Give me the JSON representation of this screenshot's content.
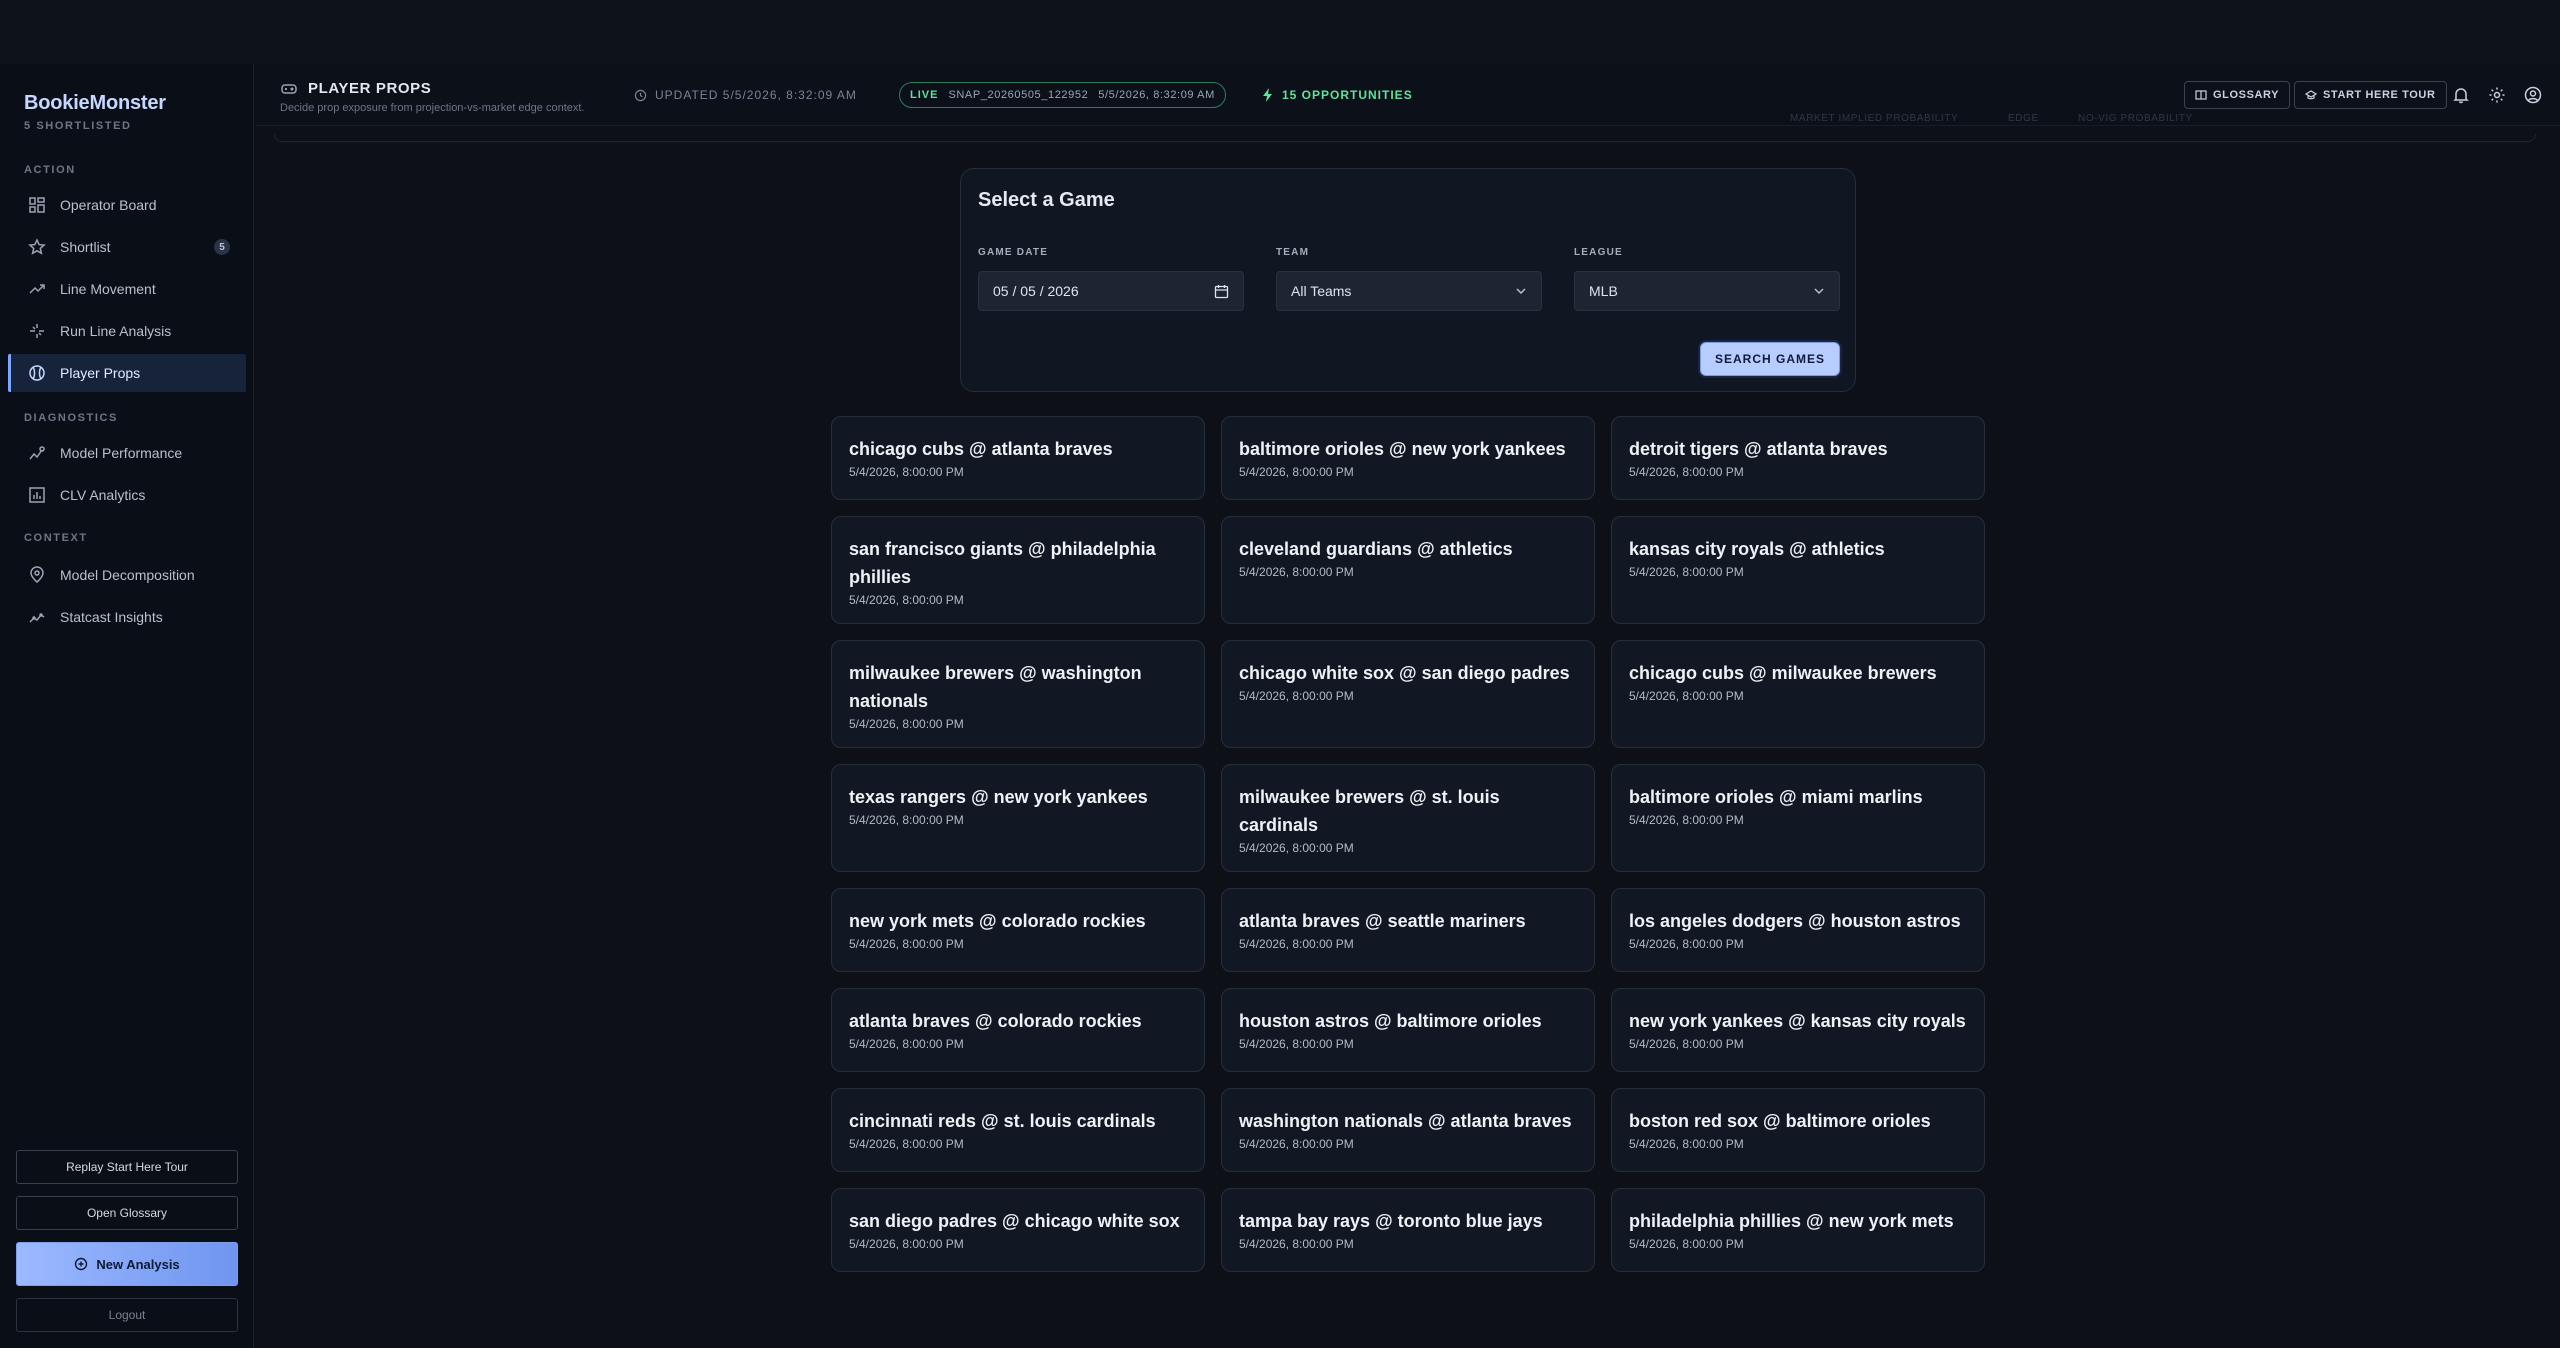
{
  "app": {
    "brand": "BookieMonster",
    "shortlisted": "5 SHORTLISTED"
  },
  "sidebar": {
    "sections": [
      {
        "label": "ACTION"
      },
      {
        "label": "DIAGNOSTICS"
      },
      {
        "label": "CONTEXT"
      }
    ],
    "items": [
      {
        "label": "Operator Board",
        "icon": "grid-icon"
      },
      {
        "label": "Shortlist",
        "icon": "star-icon",
        "badge": "5"
      },
      {
        "label": "Line Movement",
        "icon": "trend-up-icon"
      },
      {
        "label": "Run Line Analysis",
        "icon": "spread-icon"
      },
      {
        "label": "Player Props",
        "icon": "baseball-icon",
        "active": true
      },
      {
        "label": "Model Performance",
        "icon": "performance-icon"
      },
      {
        "label": "CLV Analytics",
        "icon": "bar-chart-icon"
      },
      {
        "label": "Model Decomposition",
        "icon": "decomposition-icon"
      },
      {
        "label": "Statcast Insights",
        "icon": "insights-icon"
      }
    ],
    "buttons": {
      "replay_tour": "Replay Start Here Tour",
      "open_glossary": "Open Glossary",
      "new_analysis": "New Analysis",
      "logout": "Logout"
    }
  },
  "header": {
    "title": "PLAYER PROPS",
    "description": "Decide prop exposure from projection-vs-market edge context.",
    "updated": "UPDATED 5/5/2026, 8:32:09 AM",
    "live_label": "LIVE",
    "snapshot": "SNAP_20260505_122952",
    "snapshot_time": "5/5/2026, 8:32:09 AM",
    "opportunities": "15 OPPORTUNITIES",
    "glossary_btn": "GLOSSARY",
    "tour_btn": "START HERE TOUR",
    "ghost_chips": [
      "MARKET IMPLIED PROBABILITY",
      "EDGE",
      "NO-VIG PROBABILITY"
    ]
  },
  "select_game": {
    "title": "Select a Game",
    "date_label": "GAME DATE",
    "date_value": "05 / 05 / 2026",
    "team_label": "TEAM",
    "team_value": "All Teams",
    "league_label": "LEAGUE",
    "league_value": "MLB",
    "search_btn": "SEARCH GAMES"
  },
  "games": [
    {
      "title": "chicago cubs @ atlanta braves",
      "time": "5/4/2026, 8:00:00 PM"
    },
    {
      "title": "baltimore orioles @ new york yankees",
      "time": "5/4/2026, 8:00:00 PM"
    },
    {
      "title": "detroit tigers @ atlanta braves",
      "time": "5/4/2026, 8:00:00 PM"
    },
    {
      "title": "san francisco giants @ philadelphia phillies",
      "time": "5/4/2026, 8:00:00 PM"
    },
    {
      "title": "cleveland guardians @ athletics",
      "time": "5/4/2026, 8:00:00 PM"
    },
    {
      "title": "kansas city royals @ athletics",
      "time": "5/4/2026, 8:00:00 PM"
    },
    {
      "title": "milwaukee brewers @ washington nationals",
      "time": "5/4/2026, 8:00:00 PM"
    },
    {
      "title": "chicago white sox @ san diego padres",
      "time": "5/4/2026, 8:00:00 PM"
    },
    {
      "title": "chicago cubs @ milwaukee brewers",
      "time": "5/4/2026, 8:00:00 PM"
    },
    {
      "title": "texas rangers @ new york yankees",
      "time": "5/4/2026, 8:00:00 PM"
    },
    {
      "title": "milwaukee brewers @ st. louis cardinals",
      "time": "5/4/2026, 8:00:00 PM"
    },
    {
      "title": "baltimore orioles @ miami marlins",
      "time": "5/4/2026, 8:00:00 PM"
    },
    {
      "title": "new york mets @ colorado rockies",
      "time": "5/4/2026, 8:00:00 PM"
    },
    {
      "title": "atlanta braves @ seattle mariners",
      "time": "5/4/2026, 8:00:00 PM"
    },
    {
      "title": "los angeles dodgers @ houston astros",
      "time": "5/4/2026, 8:00:00 PM"
    },
    {
      "title": "atlanta braves @ colorado rockies",
      "time": "5/4/2026, 8:00:00 PM"
    },
    {
      "title": "houston astros @ baltimore orioles",
      "time": "5/4/2026, 8:00:00 PM"
    },
    {
      "title": "new york yankees @ kansas city royals",
      "time": "5/4/2026, 8:00:00 PM"
    },
    {
      "title": "cincinnati reds @ st. louis cardinals",
      "time": "5/4/2026, 8:00:00 PM"
    },
    {
      "title": "washington nationals @ atlanta braves",
      "time": "5/4/2026, 8:00:00 PM"
    },
    {
      "title": "boston red sox @ baltimore orioles",
      "time": "5/4/2026, 8:00:00 PM"
    },
    {
      "title": "san diego padres @ chicago white sox",
      "time": "5/4/2026, 8:00:00 PM"
    },
    {
      "title": "tampa bay rays @ toronto blue jays",
      "time": "5/4/2026, 8:00:00 PM"
    },
    {
      "title": "philadelphia phillies @ new york mets",
      "time": "5/4/2026, 8:00:00 PM"
    }
  ],
  "colors": {
    "accent": "#7ea6ff",
    "live": "#5fe39a",
    "background": "#0d1117",
    "card": "#121823"
  }
}
